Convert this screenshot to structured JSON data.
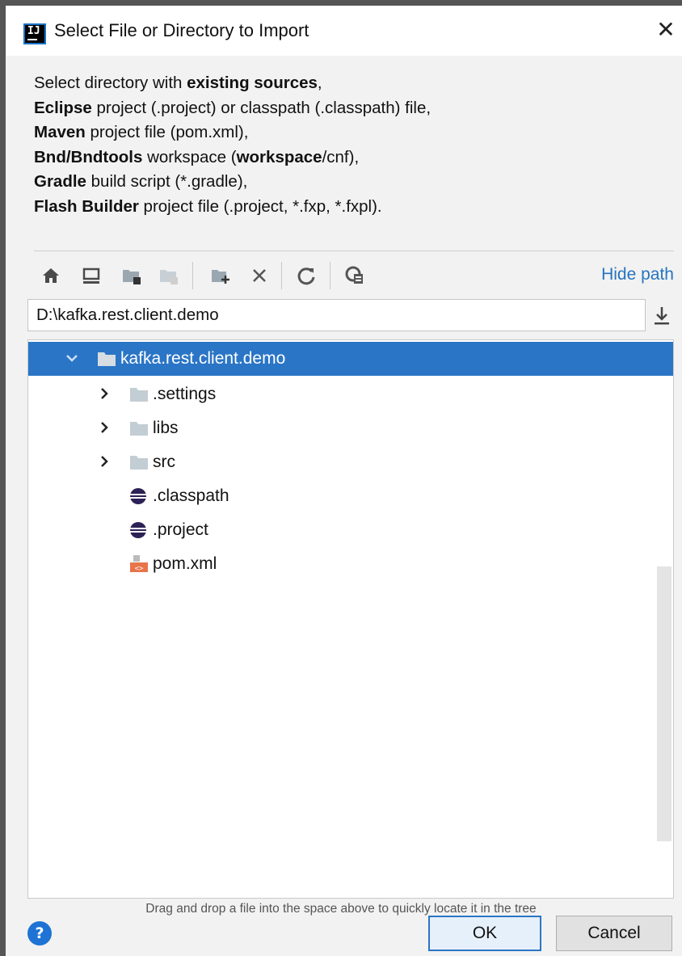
{
  "window": {
    "app_icon_text": "IJ",
    "title": "Select File or Directory to Import",
    "close_glyph": "✕"
  },
  "description": {
    "lines": [
      [
        {
          "t": "Select directory with ",
          "b": false
        },
        {
          "t": "existing sources",
          "b": true
        },
        {
          "t": ",",
          "b": false
        }
      ],
      [
        {
          "t": "Eclipse",
          "b": true
        },
        {
          "t": " project (.project) or classpath (.classpath) file,",
          "b": false
        }
      ],
      [
        {
          "t": "Maven",
          "b": true
        },
        {
          "t": " project file (pom.xml),",
          "b": false
        }
      ],
      [
        {
          "t": "Bnd/Bndtools",
          "b": true
        },
        {
          "t": " workspace (",
          "b": false
        },
        {
          "t": "workspace",
          "b": true
        },
        {
          "t": "/cnf),",
          "b": false
        }
      ],
      [
        {
          "t": "Gradle",
          "b": true
        },
        {
          "t": " build script (*.gradle),",
          "b": false
        }
      ],
      [
        {
          "t": "Flash Builder",
          "b": true
        },
        {
          "t": " project file (.project, *.fxp, *.fxpl).",
          "b": false
        }
      ]
    ]
  },
  "toolbar": {
    "buttons": [
      "home-icon",
      "desktop-icon",
      "project-folder-icon",
      "module-folder-icon",
      "new-folder-icon",
      "delete-icon",
      "refresh-icon",
      "show-hidden-icon"
    ],
    "hide_path_label": "Hide path"
  },
  "path": {
    "value": "D:\\kafka.rest.client.demo"
  },
  "tree": {
    "items": [
      {
        "label": "kafka.rest.client.demo",
        "type": "folder",
        "expanded": true,
        "selected": true,
        "level": 0
      },
      {
        "label": ".settings",
        "type": "folder",
        "expanded": false,
        "selected": false,
        "level": 1
      },
      {
        "label": "libs",
        "type": "folder",
        "expanded": false,
        "selected": false,
        "level": 1
      },
      {
        "label": "src",
        "type": "folder",
        "expanded": false,
        "selected": false,
        "level": 1
      },
      {
        "label": ".classpath",
        "type": "eclipse-file",
        "selected": false,
        "level": 1
      },
      {
        "label": ".project",
        "type": "eclipse-file",
        "selected": false,
        "level": 1
      },
      {
        "label": "pom.xml",
        "type": "xml-file",
        "selected": false,
        "level": 1
      }
    ]
  },
  "hint": "Drag and drop a file into the space above to quickly locate it in the tree",
  "buttons": {
    "help": "?",
    "ok": "OK",
    "cancel": "Cancel"
  },
  "colors": {
    "selection": "#2a75c6",
    "link": "#2675bf",
    "help": "#1e73d4"
  }
}
